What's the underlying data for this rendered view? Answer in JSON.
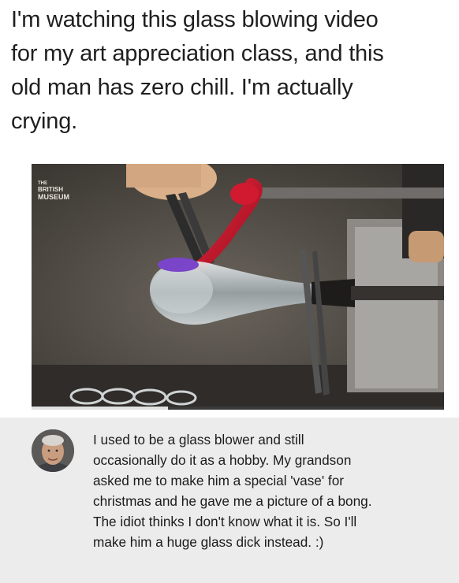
{
  "post": {
    "caption": "I'm watching this glass blowing video\nfor my art appreciation class, and this\nold man has zero chill. I'm actually\ncrying."
  },
  "video": {
    "watermark": "THE\nBRITISH\nMUSEUM",
    "progress": 0.33
  },
  "comment": {
    "text": "I used to be a glass blower and still\noccasionally do it as a hobby.  My grandson\nasked me to make him a special 'vase' for\nchristmas and he gave me a picture of a bong.\nThe idiot thinks I don't know what it is. So I'll\nmake him a huge glass dick instead. :)"
  },
  "colors": {
    "background": "#ffffff",
    "comment_bg": "#ececec",
    "molten_red": "#c8142c",
    "purple_ring": "#7a45c8"
  },
  "icons": [
    "british-museum-logo",
    "avatar-photo"
  ]
}
